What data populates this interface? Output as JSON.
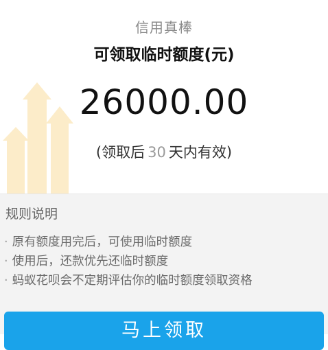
{
  "header": {
    "praise": "信用真棒",
    "title": "可领取临时额度(元)"
  },
  "amount": "26000.00",
  "validity": {
    "prefix": "(领取后",
    "days": "30",
    "suffix": "天内有效)"
  },
  "rules": {
    "title": "规则说明",
    "bullet": "·",
    "items": [
      "原有额度用完后，可使用临时额度",
      "使用后，还款优先还临时额度",
      "蚂蚁花呗会不定期评估你的临时额度领取资格"
    ]
  },
  "button": {
    "label": "马上领取"
  },
  "colors": {
    "accent": "#1aa3ea",
    "decor_arrow": "#fbe6b8"
  }
}
